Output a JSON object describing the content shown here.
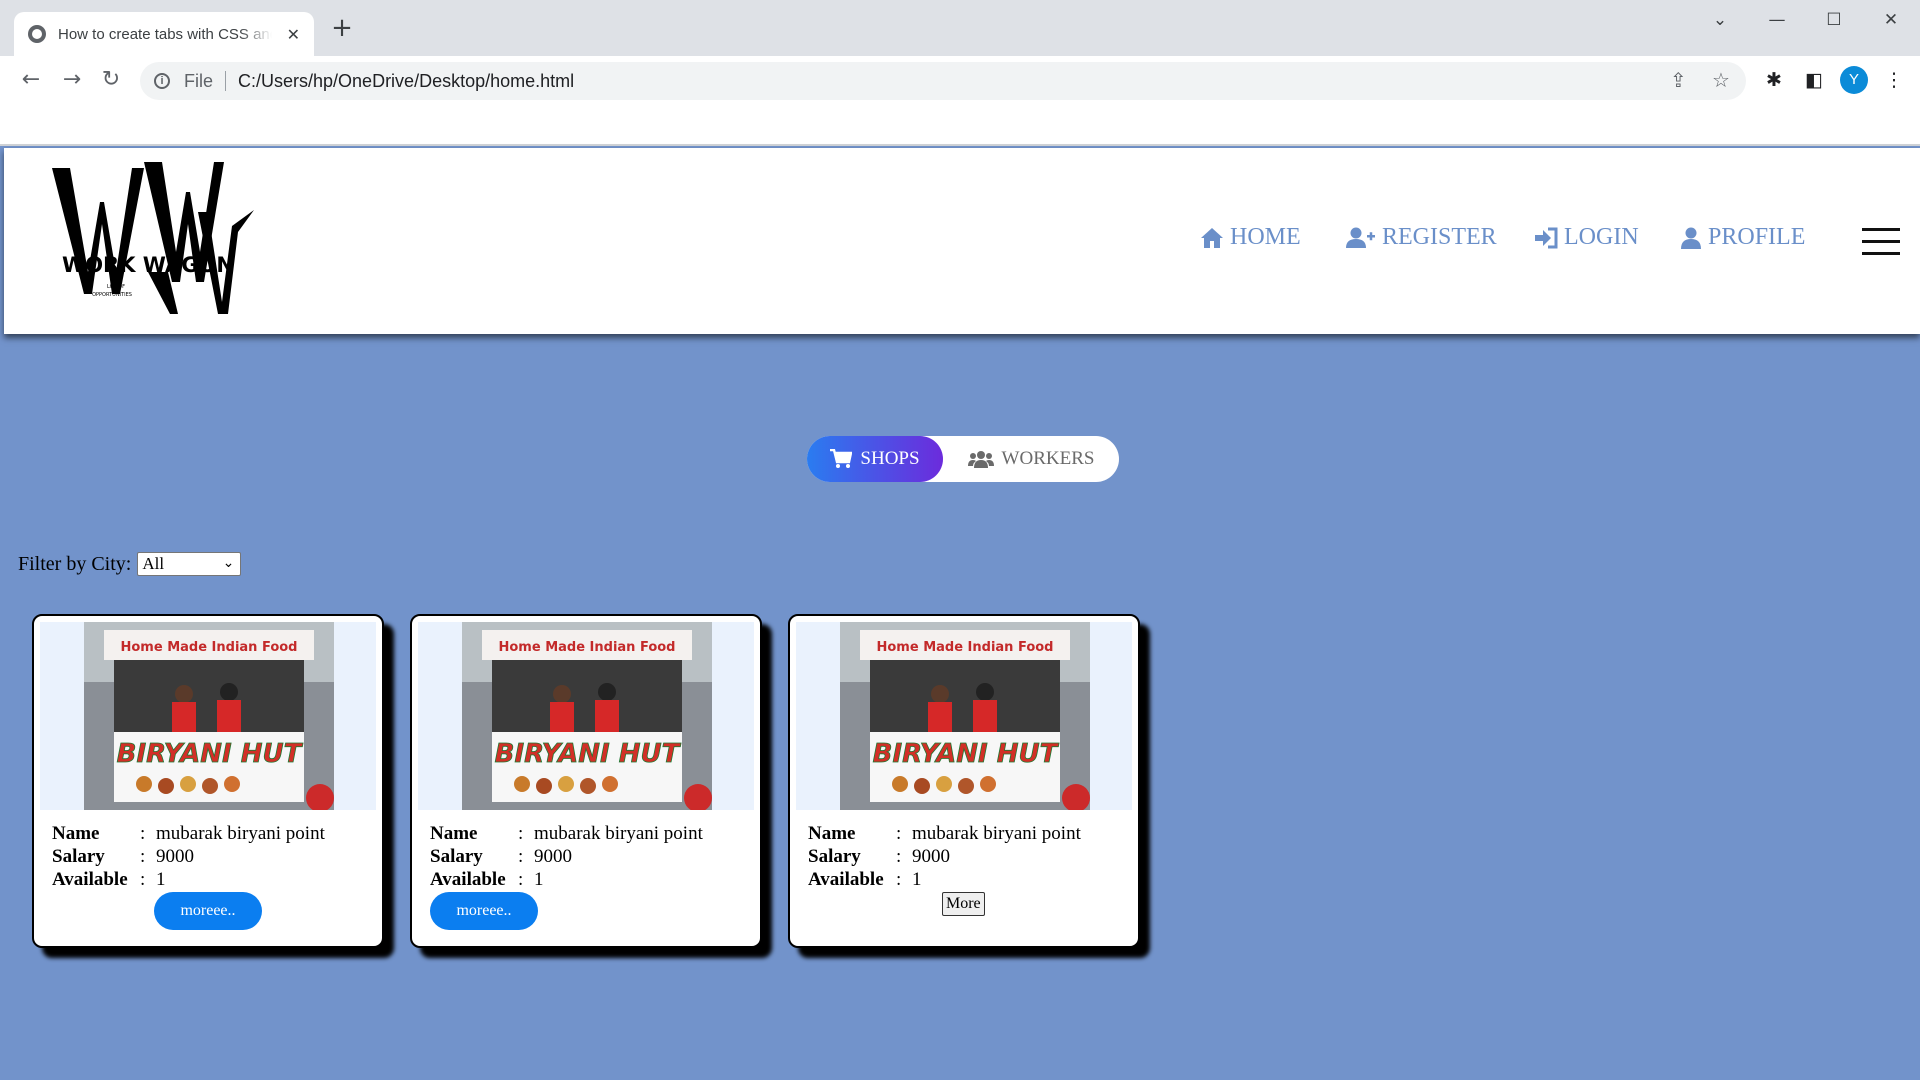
{
  "browser": {
    "tab_title": "How to create tabs with CSS and",
    "new_tab": "+",
    "close_tab": "✕",
    "file_label": "File",
    "url": "C:/Users/hp/OneDrive/Desktop/home.html",
    "avatar_letter": "Y"
  },
  "site": {
    "logo_text": "WORK WAGON",
    "logo_tagline_1": "LOT OF",
    "logo_tagline_2": "OPPORTUNITIES",
    "nav": [
      {
        "label": "HOME",
        "icon": "home-icon"
      },
      {
        "label": "REGISTER",
        "icon": "user-plus-icon"
      },
      {
        "label": "LOGIN",
        "icon": "sign-in-icon"
      },
      {
        "label": "PROFILE",
        "icon": "user-icon"
      }
    ],
    "accent_color": "#6a8fc9",
    "page_bg": "#7293cb"
  },
  "tabs": {
    "shops": "SHOPS",
    "workers": "WORKERS",
    "active": "shops"
  },
  "filter": {
    "label": "Filter by City:",
    "selected": "All"
  },
  "cards": [
    {
      "image_sign_top": "Home Made Indian Food",
      "image_sign_main": "BIRYANI HUT",
      "name_label": "Name",
      "name": "mubarak biryani point",
      "salary_label": "Salary",
      "salary": "9000",
      "available_label": "Available",
      "available": "1",
      "button": "moreee.."
    },
    {
      "image_sign_top": "Home Made Indian Food",
      "image_sign_main": "BIRYANI HUT",
      "name_label": "Name",
      "name": "mubarak biryani point",
      "salary_label": "Salary",
      "salary": "9000",
      "available_label": "Available",
      "available": "1",
      "button": "moreee.."
    },
    {
      "image_sign_top": "Home Made Indian Food",
      "image_sign_main": "BIRYANI HUT",
      "name_label": "Name",
      "name": "mubarak biryani point",
      "salary_label": "Salary",
      "salary": "9000",
      "available_label": "Available",
      "available": "1",
      "button": "More"
    }
  ]
}
